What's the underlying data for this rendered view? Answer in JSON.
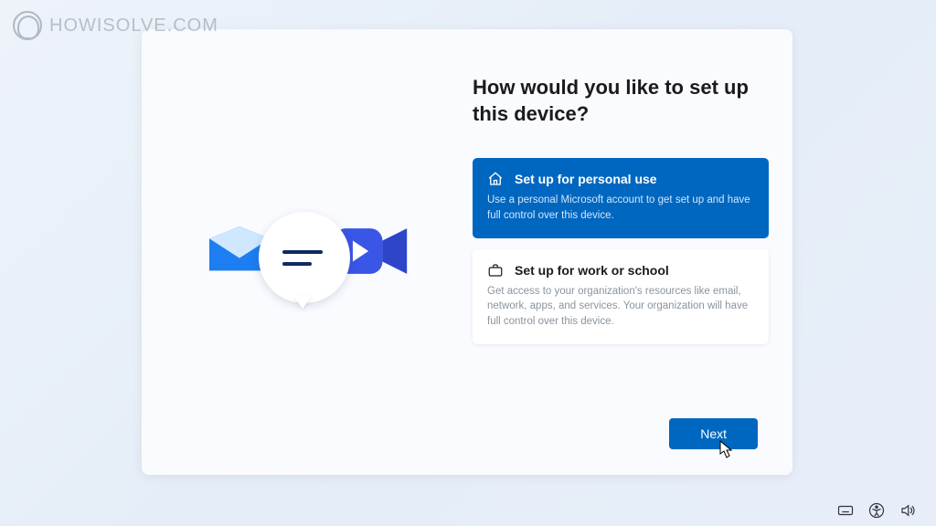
{
  "watermark": {
    "text": "HOWISOLVE.COM"
  },
  "heading": "How would you like to set up this device?",
  "options": [
    {
      "icon": "home",
      "title": "Set up for personal use",
      "desc": "Use a personal Microsoft account to get set up and have full control over this device.",
      "selected": true
    },
    {
      "icon": "briefcase",
      "title": "Set up for work or school",
      "desc": "Get access to your organization's resources like email, network, apps, and services. Your organization will have full control over this device.",
      "selected": false
    }
  ],
  "next_label": "Next",
  "colors": {
    "accent": "#0067c0"
  }
}
